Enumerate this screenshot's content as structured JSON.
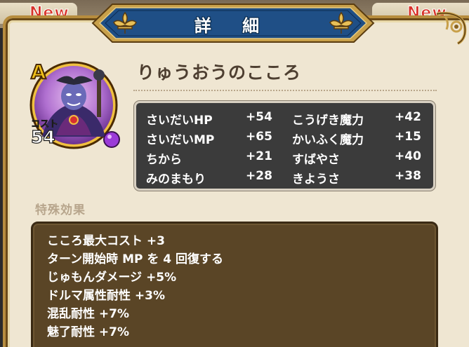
{
  "background": {
    "new_badges": [
      "New",
      "New"
    ]
  },
  "header": {
    "title": "詳 細"
  },
  "item": {
    "rank": "A",
    "name": "りゅうおうのこころ",
    "cost_label": "コスト",
    "cost_value": "54",
    "portrait_icon": "dragonlord-portrait",
    "orb_color": "#9b3ad8"
  },
  "stats": [
    {
      "label": "さいだいHP",
      "value": "+54"
    },
    {
      "label": "こうげき魔力",
      "value": "+42"
    },
    {
      "label": "さいだいMP",
      "value": "+65"
    },
    {
      "label": "かいふく魔力",
      "value": "+15"
    },
    {
      "label": "ちから",
      "value": "+21"
    },
    {
      "label": "すばやさ",
      "value": "+40"
    },
    {
      "label": "みのまもり",
      "value": "+28"
    },
    {
      "label": "きようさ",
      "value": "+38"
    }
  ],
  "special": {
    "heading": "特殊効果",
    "effects": [
      "こころ最大コスト +3",
      "ターン開始時 MP を 4 回復する",
      "じゅもんダメージ +5%",
      "ドルマ属性耐性 +3%",
      "混乱耐性 +7%",
      "魅了耐性 +7%"
    ]
  },
  "colors": {
    "panel_bg": "#efe6d2",
    "banner_blue": "#1f4f86",
    "gold": "#c8a04a",
    "stats_bg": "#3b3b3b",
    "effects_bg": "#5a4526"
  }
}
